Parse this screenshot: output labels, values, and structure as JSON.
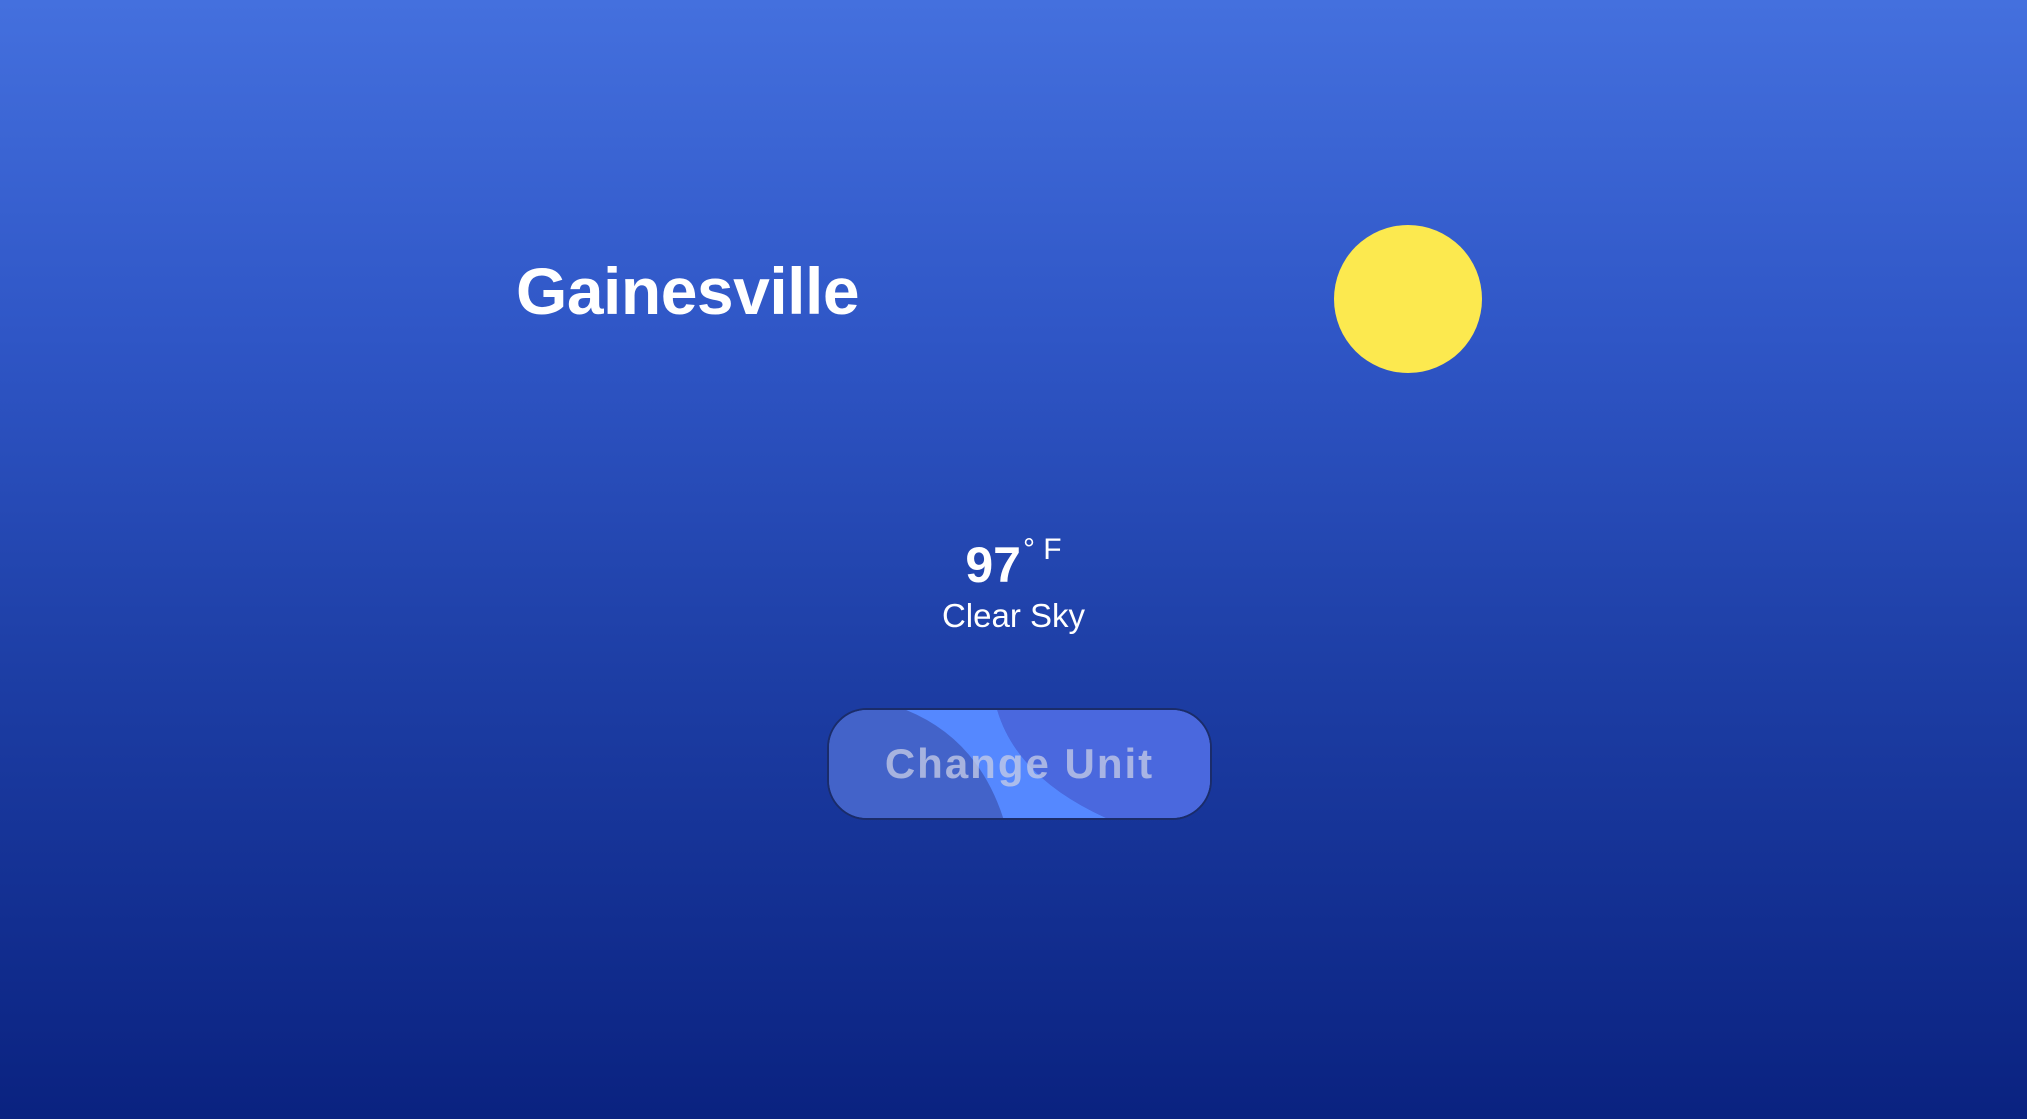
{
  "location": {
    "city": "Gainesville"
  },
  "weather": {
    "temperature": "97",
    "unit": "° F",
    "condition": "Clear Sky",
    "icon": "sun-icon"
  },
  "controls": {
    "change_unit_label": "Change Unit"
  },
  "colors": {
    "background_top": "#4470de",
    "background_bottom": "#0a2280",
    "sun": "#fce94f",
    "button_base": "#4363c9",
    "button_highlight": "#5588ff",
    "button_right": "#4a68de"
  }
}
